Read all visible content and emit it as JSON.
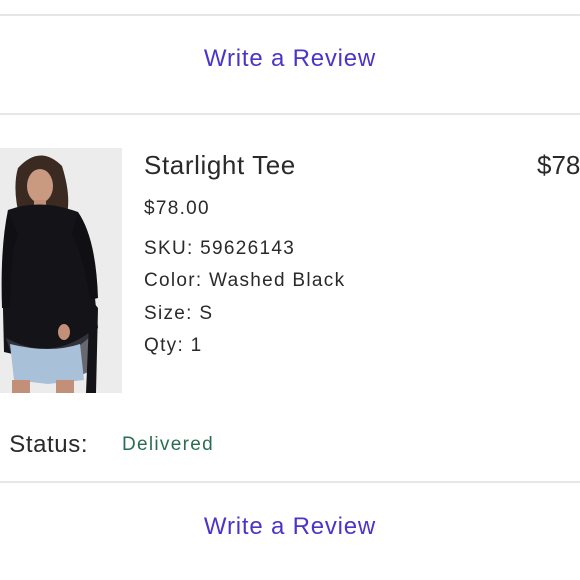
{
  "review_top": {
    "label": "Write a Review"
  },
  "item": {
    "name": "Starlight Tee",
    "price": "$78.00",
    "total": "$78",
    "sku": "SKU: 59626143",
    "color": "Color: Washed Black",
    "size": "Size: S",
    "qty": "Qty: 1",
    "image_icon": "product-photo"
  },
  "status": {
    "label": "n Status:",
    "value": "Delivered",
    "value_color": "#2a6e52"
  },
  "review_bottom": {
    "label": "Write a Review"
  },
  "colors": {
    "link": "#4a35c8",
    "divider": "#e6e6e6"
  }
}
